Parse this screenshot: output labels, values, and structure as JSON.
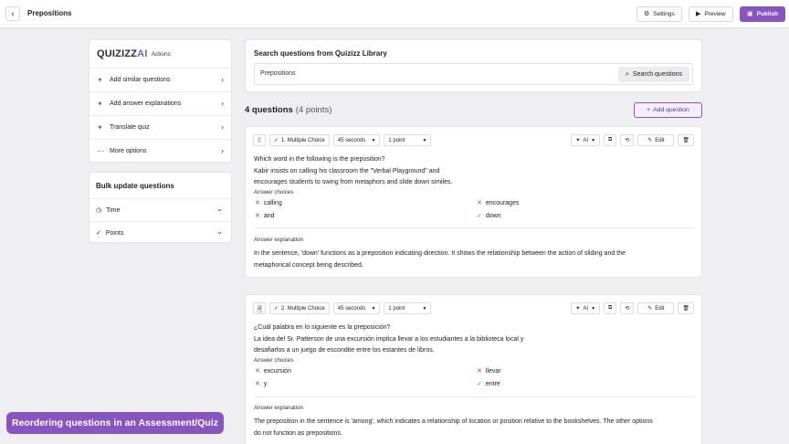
{
  "topbar": {
    "title": "Prepositions",
    "settings_label": "Settings",
    "preview_label": "Preview",
    "publish_label": "Publish"
  },
  "ai_panel": {
    "logo_text": "QUIZIZZ",
    "logo_ai": "AI",
    "actions_label": "Actions",
    "items": [
      {
        "label": "Add similar questions",
        "icon": "sparkle-icon"
      },
      {
        "label": "Add answer explanations",
        "icon": "sparkle-icon"
      },
      {
        "label": "Translate quiz",
        "icon": "sparkle-icon"
      },
      {
        "label": "More options",
        "icon": "dots-icon"
      }
    ]
  },
  "bulk_panel": {
    "title": "Bulk update questions",
    "items": [
      {
        "label": "Time",
        "icon": "clock-icon"
      },
      {
        "label": "Points",
        "icon": "check-icon"
      }
    ]
  },
  "search": {
    "title": "Search questions from Quizizz Library",
    "value": "Prepositions",
    "button_label": "Search questions"
  },
  "questions_header": {
    "count_label": "4 questions",
    "points_label": "(4 points)",
    "add_label": "Add question"
  },
  "questions": [
    {
      "type_label": "1. Multiple Choice",
      "time_label": "45 seconds",
      "points_label": "1 point",
      "ai_label": "AI",
      "edit_label": "Edit",
      "text_line1": "Which word in the following is the preposition?",
      "text_line2": "Kabir insists on calling his classroom the \"Verbal Playground\" and",
      "text_line3": "encourages students to swing from metaphors and slide down similes.",
      "answer_choices_label": "Answer choices",
      "answers": [
        {
          "text": "calling",
          "correct": false
        },
        {
          "text": "encourages",
          "correct": false
        },
        {
          "text": "and",
          "correct": false
        },
        {
          "text": "down",
          "correct": true
        }
      ],
      "explanation_label": "Answer explanation",
      "explanation_line1": "In the sentence, 'down' functions as a preposition indicating direction. It shows the relationship between the action of sliding and the",
      "explanation_line2": "metaphorical concept being described."
    },
    {
      "type_label": "2. Multiple Choice",
      "time_label": "45 seconds",
      "points_label": "1 point",
      "ai_label": "AI",
      "edit_label": "Edit",
      "text_line1": "¿Cuál palabra en lo siguiente es la preposición?",
      "text_line2": "La idea del Sr. Patterson de una excursión implica llevar a los estudiantes a la biblioteca local y",
      "text_line3": "desafiarlos a un juego de escondite entre los estantes de libros.",
      "answer_choices_label": "Answer choices",
      "answers": [
        {
          "text": "excursión",
          "correct": false
        },
        {
          "text": "llevar",
          "correct": false
        },
        {
          "text": "y",
          "correct": false
        },
        {
          "text": "entre",
          "correct": true
        }
      ],
      "explanation_label": "Answer explanation",
      "explanation_line1": "The preposition in the sentence is 'among', which indicates a relationship of location or position relative to the bookshelves. The other options",
      "explanation_line2": "do not function as prepositions."
    }
  ],
  "banner": {
    "text": "Reordering questions in an Assessment/Quiz"
  },
  "colors": {
    "accent": "#8854c0",
    "wrong": "#d93a45",
    "correct": "#1ea56b"
  }
}
